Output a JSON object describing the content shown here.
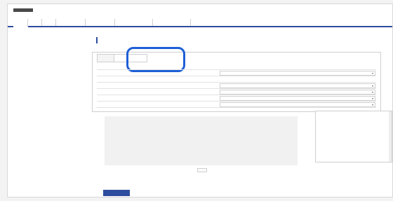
{
  "header": {
    "logo": "",
    "title": ""
  },
  "tabs": [
    {
      "label": ""
    },
    {
      "label": ""
    },
    {
      "label": ""
    },
    {
      "label": ""
    },
    {
      "label": ""
    },
    {
      "label": ""
    },
    {
      "label": ""
    }
  ],
  "sidebar": {
    "items": [
      {
        "label": ""
      },
      {
        "label": ""
      },
      {
        "label": ""
      }
    ]
  },
  "page": {
    "title": ""
  },
  "panel": {
    "tabs": [
      {
        "label": ""
      },
      {
        "label": ""
      }
    ]
  },
  "settings": {
    "rows": [
      {
        "label": "",
        "value": ""
      },
      {
        "label": "",
        "value": ""
      },
      {
        "label": "",
        "value": ""
      },
      {
        "label": "",
        "value": ""
      },
      {
        "label": "",
        "value": ""
      },
      {
        "label": "",
        "value": ""
      },
      {
        "label": "",
        "value": ""
      }
    ]
  },
  "preview": {
    "message": "",
    "button": ""
  },
  "rightbox": {
    "title": "",
    "items": [
      "",
      "",
      "",
      ""
    ]
  },
  "actions": {
    "save": ""
  },
  "colors": {
    "accent": "#2e4d9e",
    "highlight": "#1e5fd6"
  }
}
